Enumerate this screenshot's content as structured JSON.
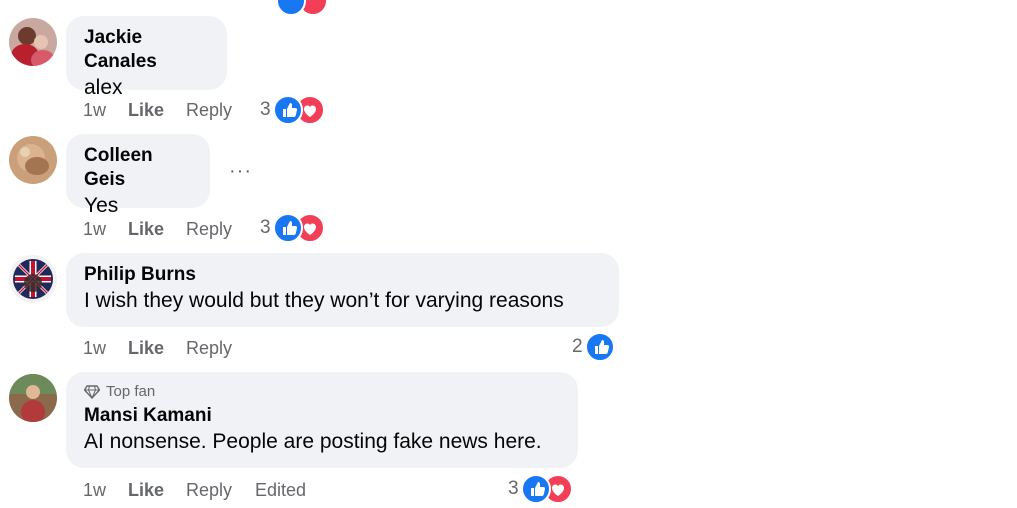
{
  "comments": [
    {
      "author": "Jackie Canales",
      "text": "alex",
      "time": "1w",
      "like_label": "Like",
      "reply_label": "Reply",
      "reaction_count": "3",
      "reactions": [
        "like-icon",
        "love-icon"
      ]
    },
    {
      "author": "Colleen Geis",
      "text": "Yes",
      "time": "1w",
      "like_label": "Like",
      "reply_label": "Reply",
      "reaction_count": "3",
      "reactions": [
        "like-icon",
        "love-icon"
      ],
      "more_label": "···"
    },
    {
      "author": "Philip Burns",
      "text": "I wish they would but they won’t for varying reasons",
      "time": "1w",
      "like_label": "Like",
      "reply_label": "Reply",
      "reaction_count": "2",
      "reactions": [
        "like-icon"
      ]
    },
    {
      "badge": "Top fan",
      "author": "Mansi Kamani",
      "text": "AI nonsense. People are posting fake news here.",
      "time": "1w",
      "like_label": "Like",
      "reply_label": "Reply",
      "edited_label": "Edited",
      "reaction_count": "3",
      "reactions": [
        "like-icon",
        "love-icon"
      ]
    }
  ],
  "colors": {
    "bubble": "#f0f2f5",
    "meta_text": "#65676b",
    "like": "#1877f2",
    "love": "#f33e58"
  }
}
